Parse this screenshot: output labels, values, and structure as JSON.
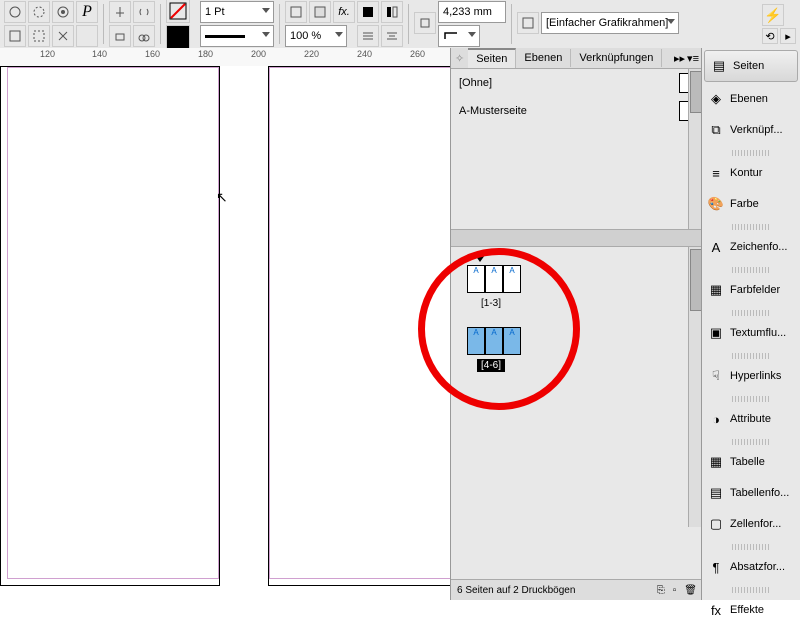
{
  "toolbar": {
    "stroke_weight": "1 Pt",
    "zoom": "100 %",
    "measurement": "4,233 mm",
    "frame_type": "[Einfacher Grafikrahmen]"
  },
  "ruler": {
    "marks": [
      "120",
      "140",
      "160",
      "180",
      "200",
      "220",
      "240",
      "260"
    ]
  },
  "dock": {
    "tabs": {
      "pages": "Seiten",
      "layers": "Ebenen",
      "links": "Verknüpfungen"
    },
    "masters": {
      "none": "[Ohne]",
      "a": "A-Musterseite"
    },
    "divider_label": "",
    "spreads": [
      {
        "label": "[1-3]",
        "selected": false,
        "pages": [
          "A",
          "A",
          "A"
        ]
      },
      {
        "label": "[4-6]",
        "selected": true,
        "pages": [
          "A",
          "A",
          "A"
        ]
      }
    ],
    "status": "6 Seiten auf 2 Druckbögen"
  },
  "side_panels": [
    {
      "icon": "pages",
      "label": "Seiten"
    },
    {
      "icon": "layers",
      "label": "Ebenen"
    },
    {
      "icon": "links",
      "label": "Verknüpf..."
    },
    {
      "sep": true
    },
    {
      "icon": "contour",
      "label": "Kontur"
    },
    {
      "icon": "color",
      "label": "Farbe"
    },
    {
      "sep": true
    },
    {
      "icon": "char",
      "label": "Zeichenfo..."
    },
    {
      "sep": true
    },
    {
      "icon": "swatch",
      "label": "Farbfelder"
    },
    {
      "sep": true
    },
    {
      "icon": "wrap",
      "label": "Textumflu..."
    },
    {
      "sep": true
    },
    {
      "icon": "hyper",
      "label": "Hyperlinks"
    },
    {
      "sep": true
    },
    {
      "icon": "attr",
      "label": "Attribute"
    },
    {
      "sep": true
    },
    {
      "icon": "table",
      "label": "Tabelle"
    },
    {
      "icon": "tstyle",
      "label": "Tabellenfo..."
    },
    {
      "icon": "cell",
      "label": "Zellenfor..."
    },
    {
      "sep": true
    },
    {
      "icon": "para",
      "label": "Absatzfor..."
    },
    {
      "sep": true
    },
    {
      "icon": "fx",
      "label": "Effekte"
    }
  ]
}
